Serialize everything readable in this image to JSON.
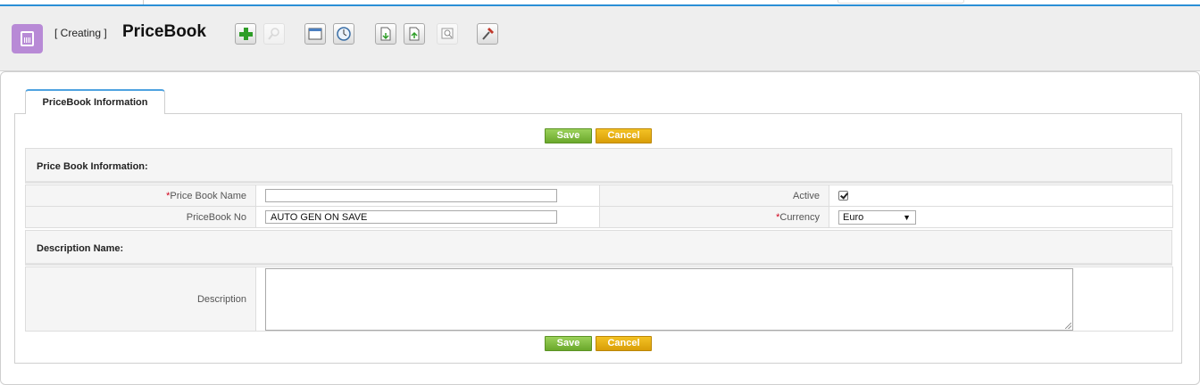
{
  "header": {
    "mode": "[ Creating ]",
    "title": "PriceBook"
  },
  "tabs": [
    {
      "label": "PriceBook Information"
    }
  ],
  "buttons": {
    "save": "Save",
    "cancel": "Cancel"
  },
  "sections": {
    "info": "Price Book Information:",
    "description": "Description Name:"
  },
  "fields": {
    "required_mark": "*",
    "price_book_name": {
      "label": "Price Book Name",
      "value": ""
    },
    "pricebook_no": {
      "label": "PriceBook No",
      "value": "AUTO GEN ON SAVE"
    },
    "active": {
      "label": "Active",
      "checked": true
    },
    "currency": {
      "label": "Currency",
      "selected": "Euro"
    },
    "description": {
      "label": "Description",
      "value": ""
    }
  },
  "toolbar_icons": [
    "add-icon",
    "search-icon",
    "calendar-icon",
    "clock-icon",
    "import-icon",
    "export-icon",
    "find-duplicates-icon",
    "settings-icon"
  ],
  "colors": {
    "accent": "#2a8fd6",
    "module": "#b88ad6",
    "save": "#7cbb3a",
    "cancel": "#e6ad12",
    "required": "#d0021b"
  }
}
